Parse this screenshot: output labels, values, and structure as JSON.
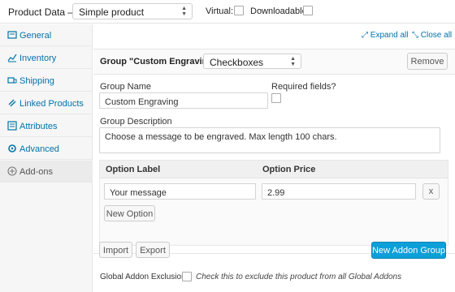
{
  "header": {
    "title": "Product Data —",
    "product_type": "Simple product",
    "virtual_label": "Virtual:",
    "downloadable_label": "Downloadable:"
  },
  "sidebar": {
    "items": [
      {
        "label": "General",
        "icon": "wrench-icon",
        "active": false
      },
      {
        "label": "Inventory",
        "icon": "inventory-icon",
        "active": false
      },
      {
        "label": "Shipping",
        "icon": "truck-icon",
        "active": false
      },
      {
        "label": "Linked Products",
        "icon": "link-icon",
        "active": false
      },
      {
        "label": "Attributes",
        "icon": "list-icon",
        "active": false
      },
      {
        "label": "Advanced",
        "icon": "gear-icon",
        "active": false
      },
      {
        "label": "Add-ons",
        "icon": "plus-circle-icon",
        "active": true
      }
    ]
  },
  "toolbar": {
    "expand_all": "Expand all",
    "close_all": "Close all"
  },
  "group": {
    "title": "Group \"Custom Engraving\" —",
    "type_value": "Checkboxes",
    "remove_label": "Remove",
    "name_label": "Group Name",
    "name_value": "Custom Engraving",
    "required_label": "Required fields?",
    "description_label": "Group Description",
    "description_value": "Choose a message to be engraved. Max length 100 chars.",
    "options": {
      "label_header": "Option Label",
      "price_header": "Option Price",
      "rows": [
        {
          "label": "Your message",
          "price": "2.99",
          "remove": "x"
        }
      ],
      "new_option_label": "New Option"
    }
  },
  "footer": {
    "import_label": "Import",
    "export_label": "Export",
    "new_group_label": "New Addon Group",
    "exclusion_label": "Global Addon Exclusion",
    "exclusion_hint": "Check this to exclude this product from all Global Addons"
  },
  "colors": {
    "link": "#0073aa",
    "primary": "#0d9fd8",
    "sidebar_bg": "#f6f6f6"
  }
}
